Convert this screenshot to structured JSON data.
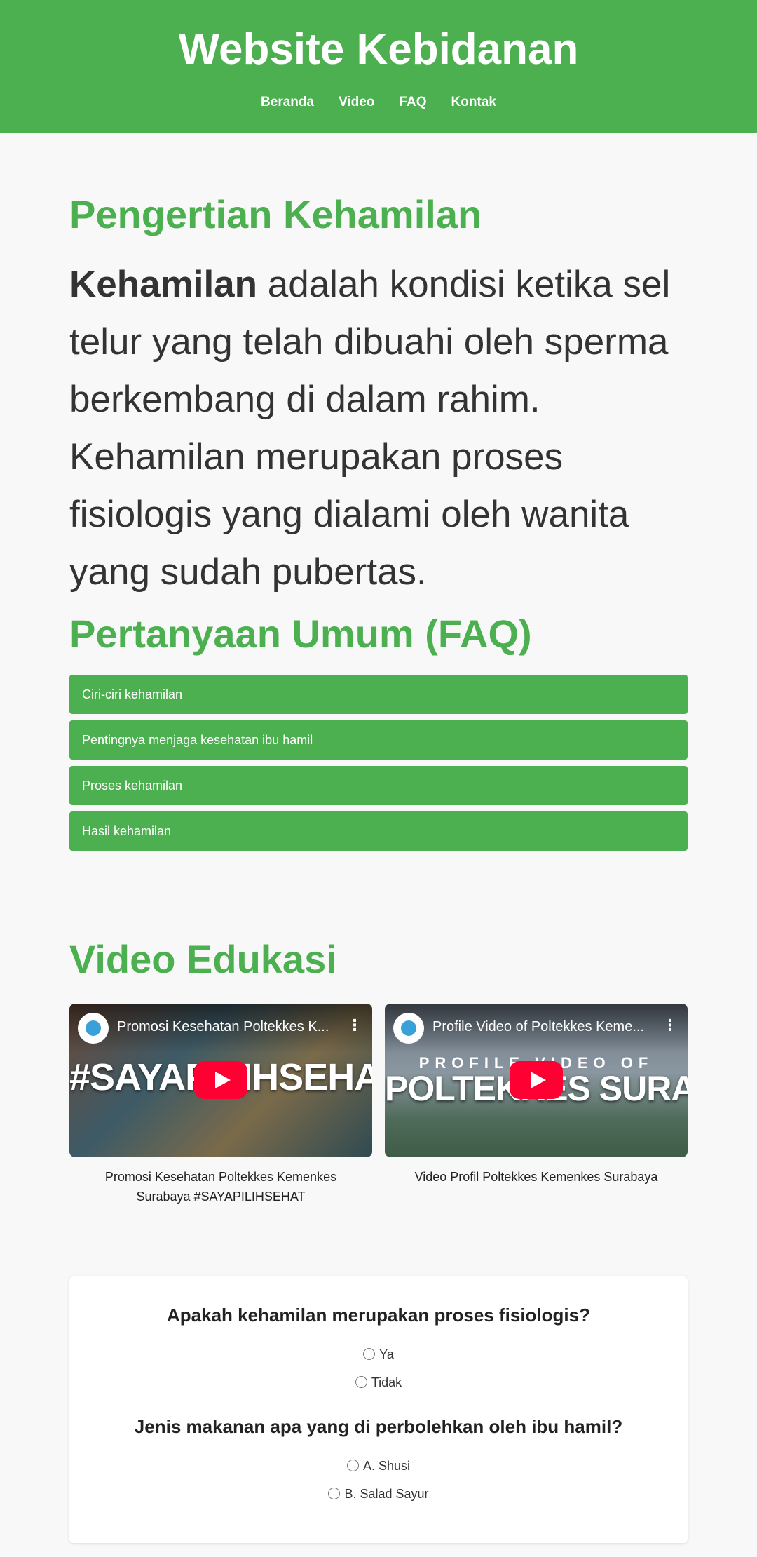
{
  "header": {
    "title": "Website Kebidanan",
    "nav": [
      "Beranda",
      "Video",
      "FAQ",
      "Kontak"
    ]
  },
  "pengertian": {
    "title": "Pengertian Kehamilan",
    "bold_word": "Kehamilan",
    "text": " adalah kondisi ketika sel telur yang telah dibuahi oleh sperma berkembang di dalam rahim. Kehamilan merupakan proses fisiologis yang dialami oleh wanita yang sudah pubertas."
  },
  "faq": {
    "title": "Pertanyaan Umum (FAQ)",
    "items": [
      "Ciri-ciri kehamilan",
      "Pentingnya menjaga kesehatan ibu hamil",
      "Proses kehamilan",
      "Hasil kehamilan"
    ]
  },
  "videos": {
    "title": "Video Edukasi",
    "items": [
      {
        "player_title": "Promosi Kesehatan Poltekkes K...",
        "thumb_text": "#SAYAPILIHSEHAT",
        "caption": "Promosi Kesehatan Poltekkes Kemenkes Surabaya #SAYAPILIHSEHAT"
      },
      {
        "player_title": "Profile Video of Poltekkes Keme...",
        "thumb_small": "PROFILE VIDEO OF",
        "thumb_text": "POLTEKKES SURABAYA",
        "caption": "Video Profil Poltekkes Kemenkes Surabaya"
      }
    ]
  },
  "quiz": {
    "questions": [
      {
        "question": "Apakah kehamilan merupakan proses fisiologis?",
        "options": [
          "Ya",
          "Tidak"
        ]
      },
      {
        "question": "Jenis makanan apa yang di perbolehkan oleh ibu hamil?",
        "options": [
          "A. Shusi",
          "B. Salad Sayur"
        ]
      }
    ]
  },
  "colors": {
    "primary": "#4caf50",
    "youtube_red": "#ff0033"
  }
}
